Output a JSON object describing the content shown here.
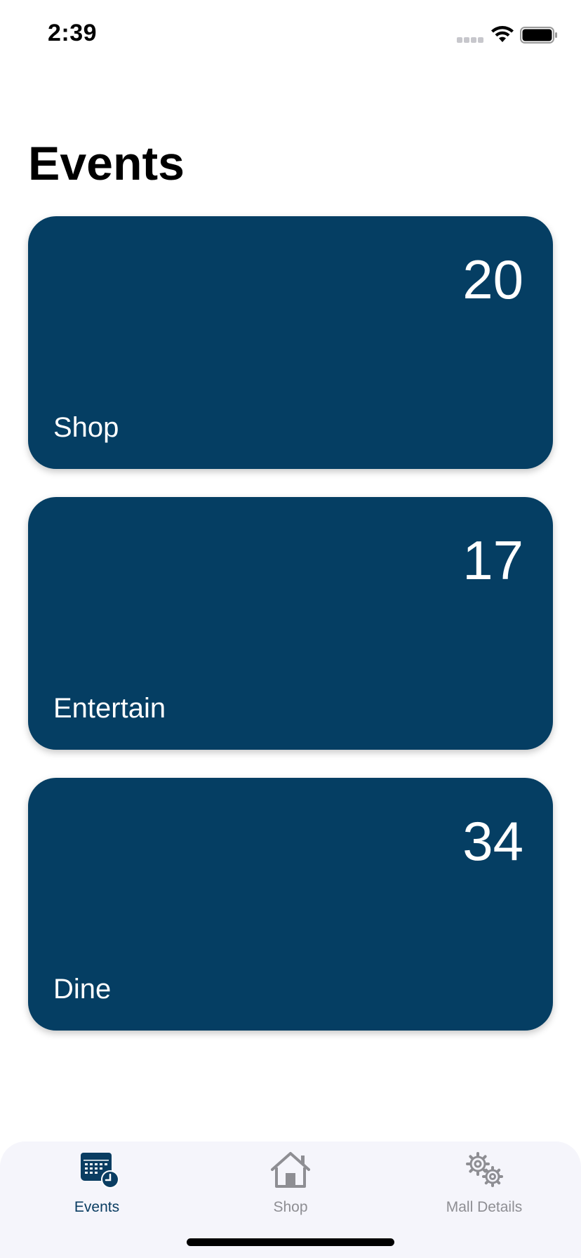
{
  "status_bar": {
    "time": "2:39"
  },
  "page": {
    "title": "Events"
  },
  "cards": [
    {
      "label": "Shop",
      "count": "20"
    },
    {
      "label": "Entertain",
      "count": "17"
    },
    {
      "label": "Dine",
      "count": "34"
    }
  ],
  "tab_bar": {
    "tabs": [
      {
        "label": "Events",
        "icon": "calendar-clock-icon",
        "selected": true
      },
      {
        "label": "Shop",
        "icon": "house-icon",
        "selected": false
      },
      {
        "label": "Mall Details",
        "icon": "gears-icon",
        "selected": false
      }
    ]
  },
  "colors": {
    "card_background": "#053e63",
    "tab_selected": "#0a3d62",
    "tab_unselected": "#8e8e93",
    "tab_bar_background": "#f5f5fb"
  }
}
